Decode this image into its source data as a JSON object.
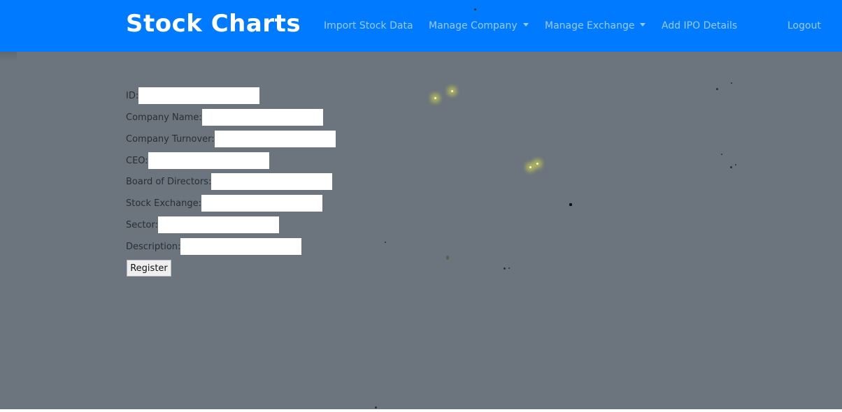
{
  "navbar": {
    "brand": "Stock Charts",
    "links": [
      {
        "label": "Import Stock Data"
      },
      {
        "label": "Manage Company"
      },
      {
        "label": "Manage Exchange"
      },
      {
        "label": "Add IPO Details"
      },
      {
        "label": "Logout"
      }
    ]
  },
  "form": {
    "fields": [
      {
        "label": "ID:",
        "value": ""
      },
      {
        "label": "Company Name:",
        "value": ""
      },
      {
        "label": "Company Turnover:",
        "value": ""
      },
      {
        "label": "CEO:",
        "value": ""
      },
      {
        "label": "Board of Directors:",
        "value": ""
      },
      {
        "label": "Stock Exchange:",
        "value": ""
      },
      {
        "label": "Sector:",
        "value": ""
      },
      {
        "label": "Description:",
        "value": ""
      }
    ],
    "submit_label": "Register"
  },
  "colors": {
    "navbar": "#007bff",
    "content_background": "#6c757d",
    "nav_link": "rgba(255,255,255,0.6)"
  }
}
